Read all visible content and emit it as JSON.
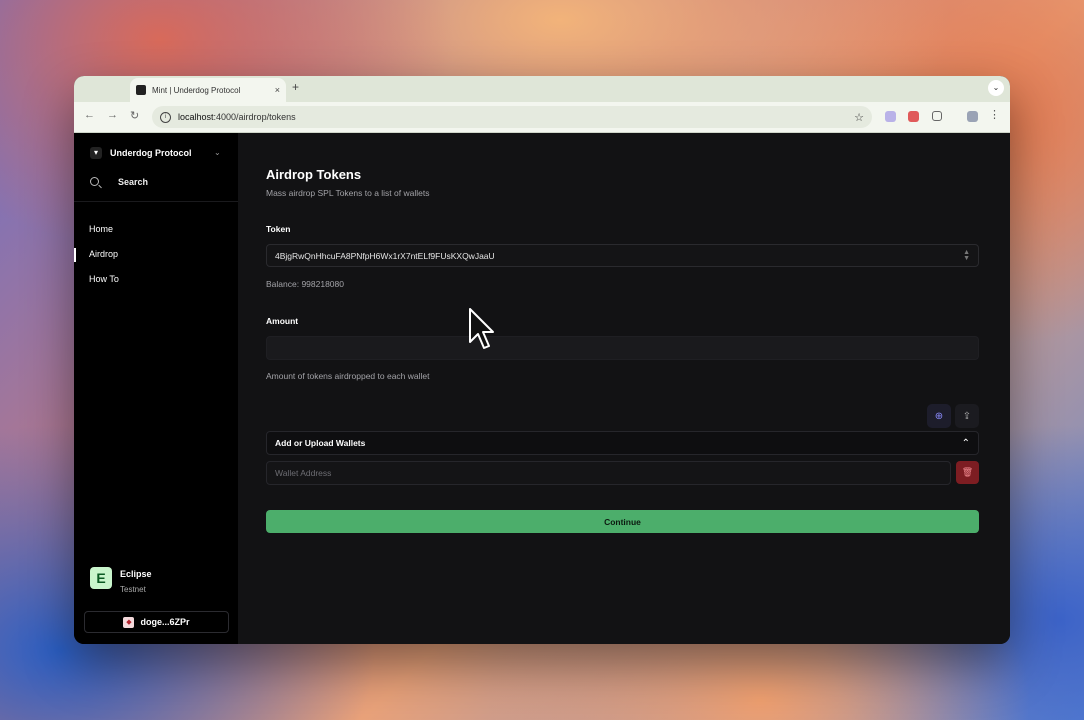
{
  "browser": {
    "tab_title": "Mint | Underdog Protocol",
    "tab_close": "×",
    "new_tab": "+",
    "url_host": "localhost",
    "url_path": ":4000/airdrop/tokens",
    "back": "←",
    "forward": "→",
    "reload": "↻",
    "star": "☆",
    "menu": "⋮",
    "profile": "⌄"
  },
  "sidebar": {
    "org_name": "Underdog Protocol",
    "org_chevron": "⌄",
    "search_label": "Search",
    "nav": [
      {
        "label": "Home"
      },
      {
        "label": "Airdrop",
        "active": true
      },
      {
        "label": "How To"
      }
    ],
    "network": {
      "badge": "E",
      "name": "Eclipse",
      "net": "Testnet"
    },
    "wallet_short": "doge...6ZPr"
  },
  "main": {
    "title": "Airdrop Tokens",
    "subtitle": "Mass airdrop SPL Tokens to a list of wallets",
    "token_label": "Token",
    "token_value": "4BjgRwQnHhcuFA8PNfpH6Wx1rX7ntELf9FUsKXQwJaaU",
    "balance": "Balance: 998218080",
    "amount_label": "Amount",
    "amount_value": "",
    "amount_help": "Amount of tokens airdropped to each wallet",
    "wallets_section": "Add or Upload Wallets",
    "wallet_placeholder": "Wallet Address",
    "continue_label": "Continue"
  },
  "colors": {
    "continue_bg": "#4cae6b",
    "delete_bg": "#7d1d22",
    "accent_icon": "#8c8cff",
    "eclipse_badge": "#c9f5cc"
  },
  "icons": [
    "search-icon",
    "plus-circle-icon",
    "upload-icon",
    "chevron-up-icon",
    "trash-icon",
    "select-arrows-icon"
  ]
}
